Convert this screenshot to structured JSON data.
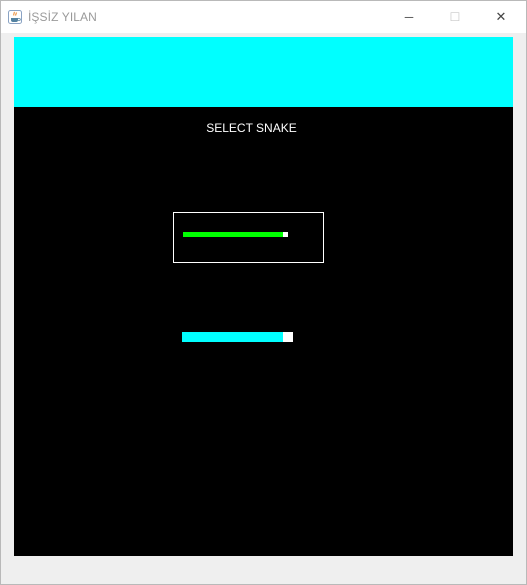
{
  "window": {
    "title": "İŞSİZ YILAN",
    "icon": "java-cup-icon",
    "controls": {
      "minimize": "─",
      "maximize": "☐",
      "close": "✕"
    }
  },
  "top_panel": {
    "color": "#00ffff"
  },
  "game": {
    "background": "#000000",
    "heading": "SELECT SNAKE",
    "options": [
      {
        "id": "green-snake",
        "body_color": "#00ff00",
        "head_color": "#ffffff",
        "selected": true
      },
      {
        "id": "cyan-snake",
        "body_color": "#00ffff",
        "head_color": "#ffffff",
        "selected": false
      }
    ]
  }
}
